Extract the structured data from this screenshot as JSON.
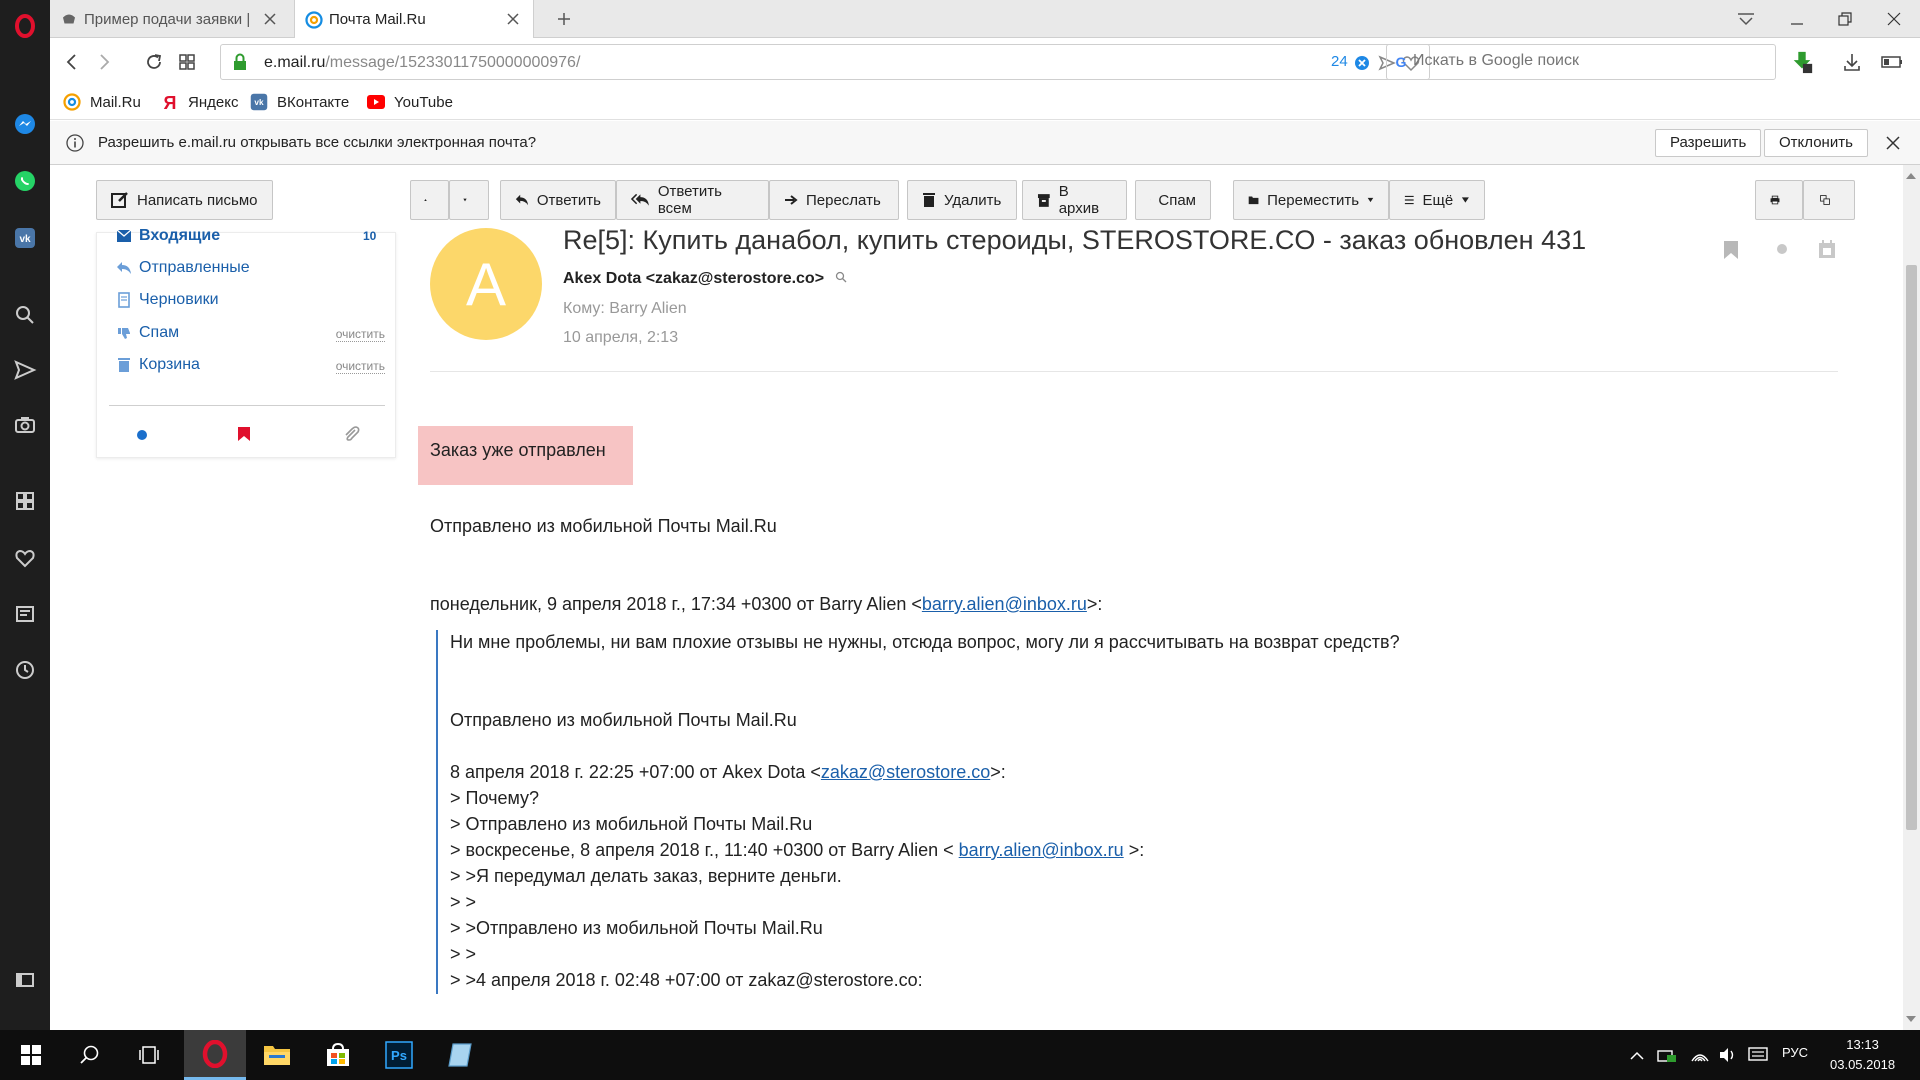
{
  "browser": {
    "tabs": [
      {
        "title": "Пример подачи заявки | "
      },
      {
        "title": "Почта Mail.Ru"
      }
    ],
    "url_host": "e.mail.ru",
    "url_path": "/message/15233011750000000976/",
    "badge_count": "24",
    "search_placeholder": "Искать в Google поиск"
  },
  "bookmarks": [
    {
      "label": "Mail.Ru",
      "icon": "mailru-icon"
    },
    {
      "label": "Яндекс",
      "icon": "yandex-icon"
    },
    {
      "label": "ВКонтакте",
      "icon": "vk-icon"
    },
    {
      "label": "YouTube",
      "icon": "youtube-icon"
    }
  ],
  "infobar": {
    "message": "Разрешить e.mail.ru открывать все ссылки электронная почта?",
    "allow": "Разрешить",
    "decline": "Отклонить"
  },
  "toolbar": {
    "compose": "Написать письмо",
    "reply": "Ответить",
    "reply_all": "Ответить всем",
    "forward": "Переслать",
    "delete": "Удалить",
    "archive": "В архив",
    "spam": "Спам",
    "move": "Переместить",
    "more": "Ещё"
  },
  "folders": [
    {
      "name": "Входящие",
      "count": "10"
    },
    {
      "name": "Отправленные"
    },
    {
      "name": "Черновики"
    },
    {
      "name": "Спам",
      "action": "очистить"
    },
    {
      "name": "Корзина",
      "action": "очистить"
    }
  ],
  "message": {
    "avatar_letter": "A",
    "subject": "Re[5]: Купить данабол, купить стероиды, STEROSTORE.CO - заказ обновлен 431",
    "sender": "Akex Dota <zakaz@sterostore.co>",
    "to": "Кому: Barry Alien",
    "date": "10 апреля, 2:13",
    "highlight": "Заказ уже отправлен",
    "sent_from": "Отправлено из мобильной Почты Mail.Ru",
    "reply_header_text": "понедельник, 9 апреля 2018 г., 17:34 +0300 от Barry Alien <",
    "reply_header_email": "barry.alien@inbox.ru",
    "reply_header_end": ">:",
    "quote": {
      "line1": "Ни мне проблемы, ни вам плохие отзывы не нужны, отсюда вопрос, могу ли я рассчитывать на возврат средств?",
      "line2": "Отправлено из мобильной Почты Mail.Ru",
      "line3_text": "8 апреля 2018 г. 22:25 +07:00 от Akex Dota <",
      "line3_email": "zakaz@sterostore.co",
      "line3_end": ">:",
      "line4": "> Почему?",
      "line5": "> Отправлено из мобильной Почты Mail.Ru",
      "line6_text": "> воскресенье, 8 апреля 2018 г., 11:40 +0300 от Barry Alien < ",
      "line6_email": "barry.alien@inbox.ru",
      "line6_end": " >:",
      "line7": "> >Я передумал делать заказ, верните деньги.",
      "line8": "> >",
      "line9": "> >Отправлено из мобильной Почты Mail.Ru",
      "line10": "> >",
      "line11": "> >4 апреля 2018 г. 02:48 +07:00 от zakaz@sterostore.co:"
    }
  },
  "taskbar": {
    "language": "РУС",
    "time": "13:13",
    "date": "03.05.2018"
  },
  "colors": {
    "sidebar": "#1e1e1e",
    "accent_link": "#1a5faa",
    "avatar": "#fcd76a",
    "highlight_bg": "#f7c4c4",
    "opera_red": "#e0102d"
  }
}
